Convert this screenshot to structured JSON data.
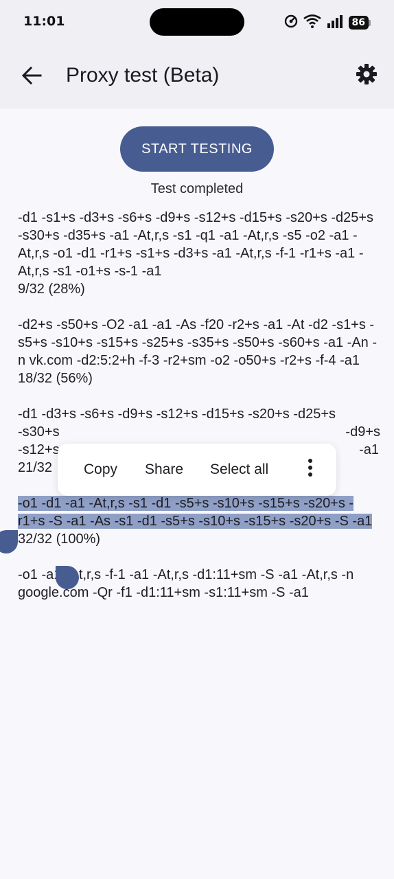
{
  "status_bar": {
    "time": "11:01",
    "battery": "86",
    "icons": [
      "data-saver-icon",
      "wifi-icon",
      "signal-icon",
      "battery-icon"
    ]
  },
  "app_bar": {
    "title": "Proxy test (Beta)",
    "back_icon": "arrow-back-icon",
    "settings_icon": "gear-icon"
  },
  "main": {
    "start_button": "START TESTING",
    "status": "Test completed"
  },
  "results": [
    {
      "strategy": "-d1 -s1+s -d3+s -s6+s -d9+s -s12+s -d15+s -s20+s -d25+s -s30+s -d35+s -a1 -At,r,s -s1 -q1 -a1 -At,r,s -s5 -o2 -a1 -At,r,s -o1 -d1 -r1+s -s1+s -d3+s -a1 -At,r,s -f-1 -r1+s -a1 -At,r,s -s1 -o1+s -s-1 -a1",
      "score": "9/32 (28%)"
    },
    {
      "strategy": "-d2+s -s50+s -O2 -a1 -a1 -As -f20 -r2+s -a1 -At -d2 -s1+s -s5+s -s10+s -s15+s -s25+s -s35+s -s50+s -s60+s -a1 -An -n vk.com -d2:5:2+h -f-3 -r2+sm -o2 -o50+s -r2+s -f-4 -a1",
      "score": "18/32 (56%)"
    },
    {
      "strategy_line1": "-d1 -d3+s -s6+s -d9+s -s12+s -d15+s -s20+s -d25+s",
      "strategy_line2_start": "-s30+s",
      "strategy_line2_end": "-d9+s",
      "strategy_line3_start": "-s12+s",
      "strategy_line3_end": "-a1",
      "score": "21/32"
    },
    {
      "strategy": "-o1 -d1 -a1 -At,r,s -s1 -d1 -s5+s -s10+s -s15+s -s20+s -r1+s -S -a1 -As -s1 -d1 -s5+s -s10+s -s15+s -s20+s -S -a1",
      "score": "32/32 (100%)"
    },
    {
      "strategy": "-o1 -a1 -At,r,s -f-1 -a1 -At,r,s -d1:11+sm -S -a1 -At,r,s -n google.com -Qr -f1 -d1:11+sm -s1:11+sm -S -a1",
      "score": ""
    }
  ],
  "context_menu": {
    "copy": "Copy",
    "share": "Share",
    "select_all": "Select all",
    "more_icon": "more-vert-icon"
  },
  "colors": {
    "primary": "#475d92",
    "selection": "#8f9fc6",
    "app_bar_bg": "#efeff4",
    "page_bg": "#f8f8fc"
  }
}
